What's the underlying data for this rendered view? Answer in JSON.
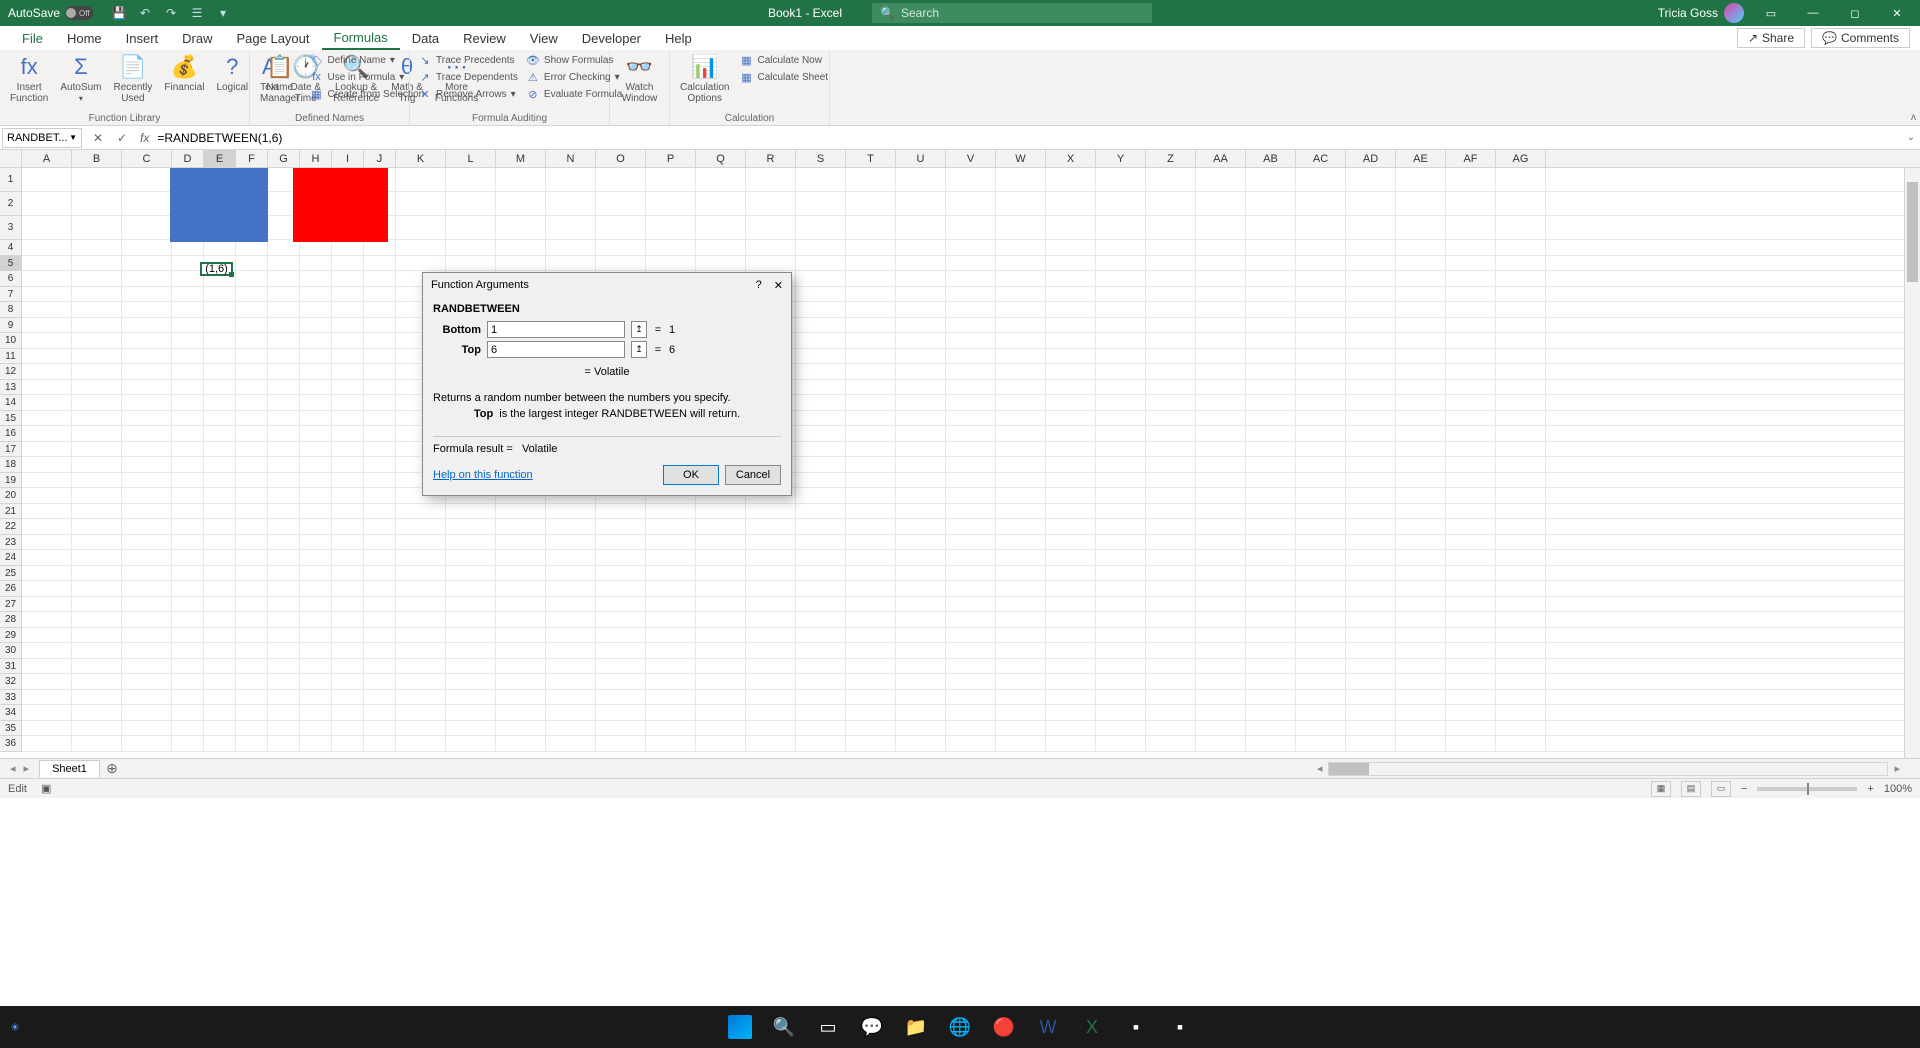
{
  "title_bar": {
    "autosave_label": "AutoSave",
    "autosave_state": "Off",
    "doc_title": "Book1  -  Excel",
    "search_placeholder": "Search",
    "user_name": "Tricia Goss"
  },
  "menu": {
    "file": "File",
    "home": "Home",
    "insert": "Insert",
    "draw": "Draw",
    "page_layout": "Page Layout",
    "formulas": "Formulas",
    "data": "Data",
    "review": "Review",
    "view": "View",
    "developer": "Developer",
    "help": "Help",
    "share": "Share",
    "comments": "Comments"
  },
  "ribbon": {
    "insert_function": "Insert\nFunction",
    "autosum": "AutoSum",
    "recently_used": "Recently\nUsed",
    "financial": "Financial",
    "logical": "Logical",
    "text": "Text",
    "date_time": "Date &\nTime",
    "lookup_ref": "Lookup &\nReference",
    "math_trig": "Math &\nTrig",
    "more_functions": "More\nFunctions",
    "group_function_library": "Function Library",
    "name_manager": "Name\nManager",
    "define_name": "Define Name",
    "use_in_formula": "Use in Formula",
    "create_from_selection": "Create from Selection",
    "group_defined_names": "Defined Names",
    "trace_precedents": "Trace Precedents",
    "trace_dependents": "Trace Dependents",
    "remove_arrows": "Remove Arrows",
    "show_formulas": "Show Formulas",
    "error_checking": "Error Checking",
    "evaluate_formula": "Evaluate Formula",
    "group_formula_auditing": "Formula Auditing",
    "watch_window": "Watch\nWindow",
    "calculation_options": "Calculation\nOptions",
    "calculate_now": "Calculate Now",
    "calculate_sheet": "Calculate Sheet",
    "group_calculation": "Calculation"
  },
  "formula_bar": {
    "name_box": "RANDBET...",
    "formula": "=RANDBETWEEN(1,6)"
  },
  "columns": [
    "A",
    "B",
    "C",
    "D",
    "E",
    "F",
    "G",
    "H",
    "I",
    "J",
    "K",
    "L",
    "M",
    "N",
    "O",
    "P",
    "Q",
    "R",
    "S",
    "T",
    "U",
    "V",
    "W",
    "X",
    "Y",
    "Z",
    "AA",
    "AB",
    "AC",
    "AD",
    "AE",
    "AF",
    "AG"
  ],
  "active_cell_display": "(1,6)",
  "dialog": {
    "title": "Function Arguments",
    "function_name": "RANDBETWEEN",
    "arg1_label": "Bottom",
    "arg1_value": "1",
    "arg1_result": "1",
    "arg2_label": "Top",
    "arg2_value": "6",
    "arg2_result": "6",
    "volatile": "Volatile",
    "description": "Returns a random number between the numbers you specify.",
    "arg_hint_label": "Top",
    "arg_hint_text": "is the largest integer RANDBETWEEN will return.",
    "result_label": "Formula result =",
    "result_value": "Volatile",
    "help_link": "Help on this function",
    "ok": "OK",
    "cancel": "Cancel"
  },
  "sheets": {
    "sheet1": "Sheet1"
  },
  "status": {
    "mode": "Edit",
    "zoom": "100%"
  },
  "colored_blocks": {
    "blue": {
      "cells": "D1:E3",
      "color": "#4472C4"
    },
    "red": {
      "cells": "H1:I3",
      "color": "#FF0000"
    }
  }
}
